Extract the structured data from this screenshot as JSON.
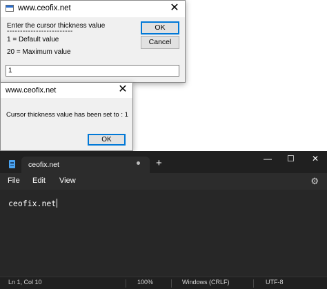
{
  "input_dialog": {
    "title": "www.ceofix.net",
    "close": "✕",
    "prompt_line1": "Enter the cursor thickness value",
    "separator": "-------------------------",
    "prompt_line2": "1 = Default value",
    "prompt_line3": "20 = Maximum value",
    "ok_label": "OK",
    "cancel_label": "Cancel",
    "input_value": "1"
  },
  "message_dialog": {
    "title": "www.ceofix.net",
    "close": "✕",
    "message": "Cursor thickness value has been set to : 1",
    "ok_label": "OK"
  },
  "notepad": {
    "tab_label": "ceofix.net",
    "new_tab": "+",
    "window_controls": {
      "minimize": "—",
      "maximize": "☐",
      "close": "✕"
    },
    "menu": [
      "File",
      "Edit",
      "View"
    ],
    "settings_icon": "⚙",
    "content": "ceofix.net",
    "status": {
      "position": "Ln 1, Col 10",
      "zoom": "100%",
      "line_ending": "Windows (CRLF)",
      "encoding": "UTF-8"
    },
    "colors": {
      "background": "#202020",
      "editor": "#272727",
      "accent": "#4aa3f0"
    }
  }
}
